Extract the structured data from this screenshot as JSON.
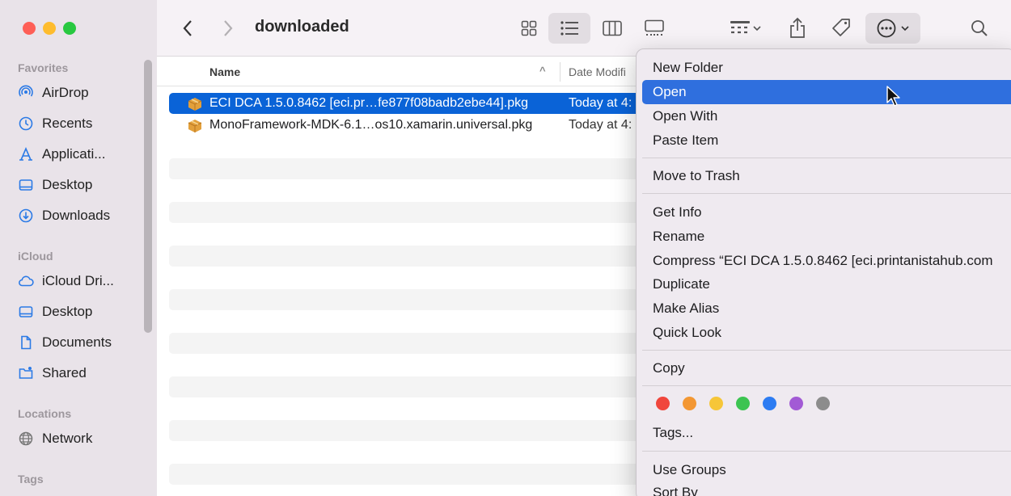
{
  "sidebar": {
    "sections": {
      "favorites": "Favorites",
      "icloud": "iCloud",
      "locations": "Locations",
      "tags": "Tags"
    },
    "items": {
      "airdrop": "AirDrop",
      "recents": "Recents",
      "applications": "Applicati...",
      "desktop": "Desktop",
      "downloads": "Downloads",
      "icloud_drive": "iCloud Dri...",
      "icloud_desktop": "Desktop",
      "documents": "Documents",
      "shared": "Shared",
      "network": "Network"
    }
  },
  "toolbar": {
    "title": "downloaded",
    "active_view": "list"
  },
  "list": {
    "col_name": "Name",
    "col_date": "Date Modifi",
    "sort_indicator": "^",
    "files": [
      {
        "name": "ECI DCA 1.5.0.8462 [eci.pr…fe877f08badb2ebe44].pkg",
        "date": "Today at 4:",
        "selected": true
      },
      {
        "name": "MonoFramework-MDK-6.1…os10.xamarin.universal.pkg",
        "date": "Today at 4:",
        "selected": false
      }
    ]
  },
  "menu": {
    "new_folder": "New Folder",
    "open": "Open",
    "open_with": "Open With",
    "paste_item": "Paste Item",
    "move_to_trash": "Move to Trash",
    "get_info": "Get Info",
    "rename": "Rename",
    "compress": "Compress “ECI DCA 1.5.0.8462 [eci.printanistahub.com",
    "duplicate": "Duplicate",
    "make_alias": "Make Alias",
    "quick_look": "Quick Look",
    "copy": "Copy",
    "tags": "Tags...",
    "use_groups": "Use Groups",
    "sort_by": "Sort By",
    "tag_colors": [
      "#f0463c",
      "#f39733",
      "#f6c638",
      "#3cc451",
      "#2d7cf2",
      "#a25ad5",
      "#8c8c8c"
    ]
  },
  "colors": {
    "selection": "#0a63d7",
    "menu_highlight": "#2f6fde"
  }
}
